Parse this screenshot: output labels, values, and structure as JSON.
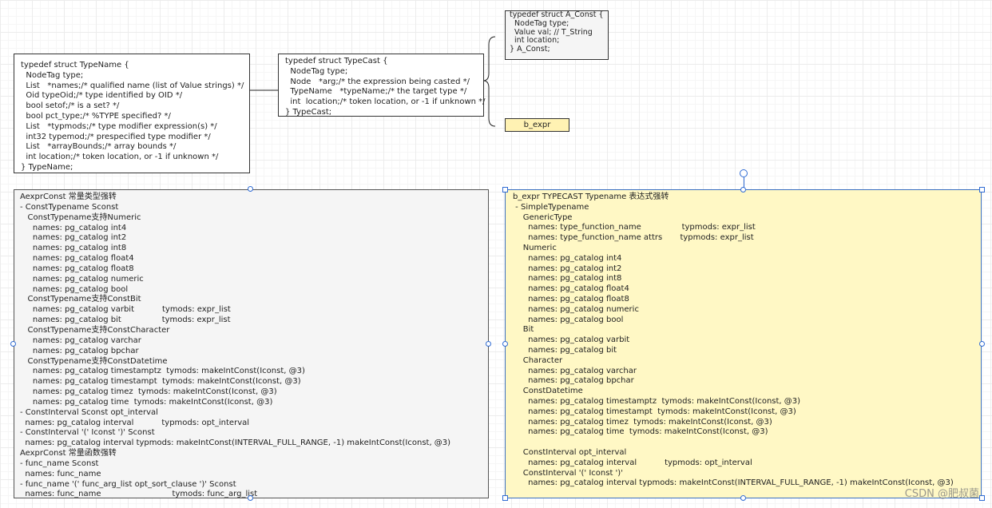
{
  "typename_struct": "typedef struct TypeName {\n  NodeTag type;\n  List   *names;/* qualified name (list of Value strings) */\n  Oid typeOid;/* type identified by OID */\n  bool setof;/* is a set? */\n  bool pct_type;/* %TYPE specified? */\n  List   *typmods;/* type modifier expression(s) */\n  int32 typemod;/* prespecified type modifier */\n  List   *arrayBounds;/* array bounds */\n  int location;/* token location, or -1 if unknown */\n} TypeName;",
  "typecast_struct": "typedef struct TypeCast {\n  NodeTag type;\n  Node   *arg;/* the expression being casted */\n  TypeName   *typeName;/* the target type */\n  int  location;/* token location, or -1 if unknown */\n} TypeCast;",
  "aconst_struct": "typedef struct A_Const {\n  NodeTag type;\n  Value val; // T_String\n  int location;\n} A_Const;",
  "bexpr_label": "b_expr",
  "aexpr_text": "AexprConst 常量类型强转\n- ConstTypename Sconst\n   ConstTypename支持Numeric\n     names: pg_catalog int4\n     names: pg_catalog int2\n     names: pg_catalog int8\n     names: pg_catalog float4\n     names: pg_catalog float8\n     names: pg_catalog numeric\n     names: pg_catalog bool\n   ConstTypename支持ConstBit\n     names: pg_catalog varbit           tymods: expr_list\n     names: pg_catalog bit                tymods: expr_list\n   ConstTypename支持ConstCharacter\n     names: pg_catalog varchar\n     names: pg_catalog bpchar\n   ConstTypename支持ConstDatetime\n     names: pg_catalog timestamptz  tymods: makeIntConst(Iconst, @3)\n     names: pg_catalog timestampt  tymods: makeIntConst(Iconst, @3)\n     names: pg_catalog timez  tymods: makeIntConst(Iconst, @3)\n     names: pg_catalog time  tymods: makeIntConst(Iconst, @3)\n- ConstInterval Sconst opt_interval\n  names: pg_catalog interval           typmods: opt_interval\n- ConstInterval '(' Iconst ')' Sconst\n  names: pg_catalog interval typmods: makeIntConst(INTERVAL_FULL_RANGE, -1) makeIntConst(Iconst, @3)\nAexprConst 常量函数强转\n- func_name Sconst\n  names: func_name\n- func_name '(' func_arg_list opt_sort_clause ')' Sconst\n  names: func_name                            tymods: func_arg_list",
  "bexpr_text": "b_expr TYPECAST Typename 表达式强转\n - SimpleTypename\n    GenericType\n      names: type_function_name                typmods: expr_list\n      names: type_function_name attrs       typmods: expr_list\n    Numeric\n      names: pg_catalog int4\n      names: pg_catalog int2\n      names: pg_catalog int8\n      names: pg_catalog float4\n      names: pg_catalog float8\n      names: pg_catalog numeric\n      names: pg_catalog bool\n    Bit\n      names: pg_catalog varbit\n      names: pg_catalog bit\n    Character\n      names: pg_catalog varchar\n      names: pg_catalog bpchar\n    ConstDatetime\n      names: pg_catalog timestamptz  tymods: makeIntConst(Iconst, @3)\n      names: pg_catalog timestampt  tymods: makeIntConst(Iconst, @3)\n      names: pg_catalog timez  tymods: makeIntConst(Iconst, @3)\n      names: pg_catalog time  tymods: makeIntConst(Iconst, @3)\n\n    ConstInterval opt_interval\n      names: pg_catalog interval           typmods: opt_interval\n    ConstInterval '(' Iconst ')'\n      names: pg_catalog interval typmods: makeIntConst(INTERVAL_FULL_RANGE, -1) makeIntConst(Iconst, @3)",
  "watermark": "CSDN @肥叔菌",
  "colors": {
    "selection": "#2f6bd3",
    "note_yellow": "#fff8c5",
    "note_gray": "#f5f5f5",
    "label_yellow": "#fff2b3"
  }
}
